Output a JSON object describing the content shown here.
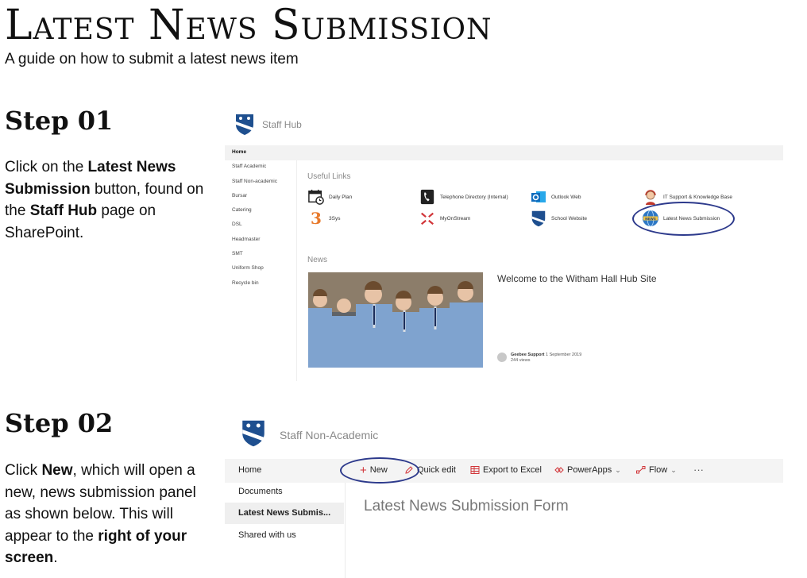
{
  "header": {
    "title": "Latest News Submission",
    "subtitle": "A guide on how to submit a latest news item"
  },
  "step1": {
    "title": "Step 01",
    "text": [
      {
        "t": "Click on the ",
        "b": false
      },
      {
        "t": "Latest News Submission",
        "b": true
      },
      {
        "t": " button, found on the ",
        "b": false
      },
      {
        "t": "Staff Hub",
        "b": true
      },
      {
        "t": " page on SharePoint.",
        "b": false
      }
    ],
    "screenshot": {
      "site_name": "Staff Hub",
      "nav": [
        "Home",
        "Staff Academic",
        "Staff Non-academic",
        "Bursar",
        "Catering",
        "DSL",
        "Headmaster",
        "SMT",
        "Uniform Shop",
        "Recycle bin"
      ],
      "useful_links_label": "Useful Links",
      "links": [
        {
          "label": "Daily Plan",
          "icon": "calendar-clock-icon"
        },
        {
          "label": "Telephone Directory (Internal)",
          "icon": "phone-icon"
        },
        {
          "label": "Outlook Web",
          "icon": "outlook-icon"
        },
        {
          "label": "IT Support & Knowledge Base",
          "icon": "support-agent-icon"
        },
        {
          "label": "3Sys",
          "icon": "3sys-logo-icon",
          "icon_text": "3"
        },
        {
          "label": "MyOnStream",
          "icon": "myonstream-icon"
        },
        {
          "label": "School Website",
          "icon": "school-crest-icon"
        },
        {
          "label": "Latest News Submission",
          "icon": "news-globe-icon",
          "icon_text": "NEWS"
        }
      ],
      "news_label": "News",
      "news_title": "Welcome to the Witham Hall Hub Site",
      "author": "Geebee Support",
      "date": "1 September 2019",
      "views": "244 views"
    }
  },
  "step2": {
    "title": "Step 02",
    "text": [
      {
        "t": "Click ",
        "b": false
      },
      {
        "t": "New",
        "b": true
      },
      {
        "t": ", which will open a new, news submission panel as shown below. This will appear to the ",
        "b": false
      },
      {
        "t": "right of your screen",
        "b": true
      },
      {
        "t": ".",
        "b": false
      }
    ],
    "screenshot": {
      "site_name": "Staff Non-Academic",
      "nav": [
        "Home",
        "Documents",
        "Latest News Submis...",
        "Shared with us"
      ],
      "commands": {
        "new": "New",
        "quick_edit": "Quick edit",
        "export": "Export to Excel",
        "powerapps": "PowerApps",
        "flow": "Flow",
        "more": "···"
      },
      "form_title": "Latest News Submission Form"
    }
  },
  "colors": {
    "highlight_ellipse": "#2d3a8c",
    "crest_blue": "#1e4f8f",
    "accent_red": "#d13438",
    "outlook_blue": "#0f6cbd",
    "threesys_orange": "#e87a2c"
  }
}
